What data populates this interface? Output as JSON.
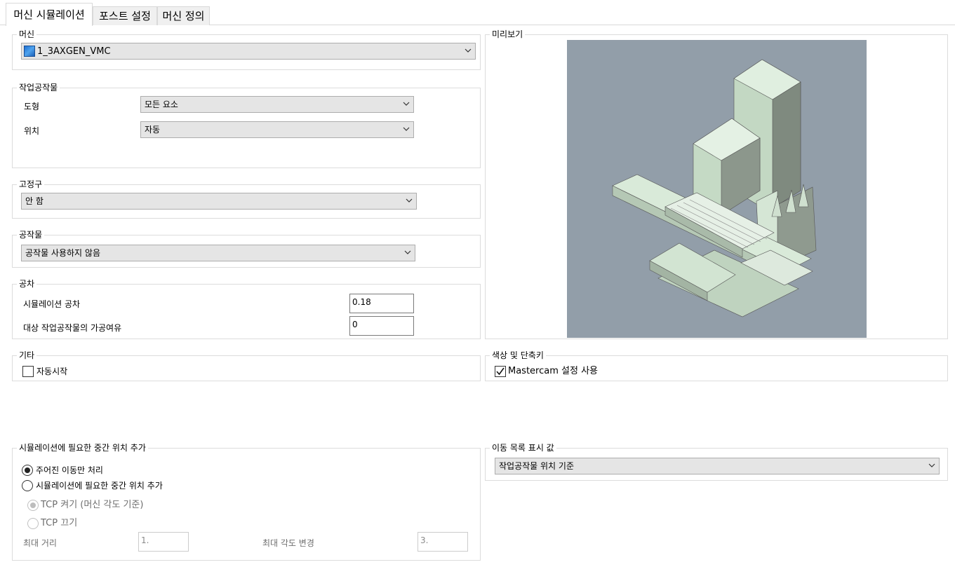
{
  "tabs": [
    {
      "label": "머신 시뮬레이션",
      "active": true
    },
    {
      "label": "포스트 설정",
      "active": false
    },
    {
      "label": "머신 정의",
      "active": false
    }
  ],
  "machine": {
    "legend": "머신",
    "selected": "1_3AXGEN_VMC",
    "icon": "machine-icon"
  },
  "workpiece": {
    "legend": "작업공작물",
    "geometry_label": "도형",
    "geometry_value": "모든 요소",
    "position_label": "위치",
    "position_value": "자동"
  },
  "fixture": {
    "legend": "고정구",
    "value": "안 함"
  },
  "stock": {
    "legend": "공작물",
    "value": "공작물 사용하지 않음"
  },
  "tolerance": {
    "legend": "공차",
    "sim_label": "시뮬레이션 공차",
    "sim_value": "0.18",
    "allowance_label": "대상 작업공작물의 가공여유",
    "allowance_value": "0"
  },
  "other": {
    "legend": "기타",
    "autostart_label": "자동시작",
    "autostart_checked": false
  },
  "colors_shortcuts": {
    "legend": "색상 및 단축키",
    "use_mastercam_label": "Mastercam 설정 사용",
    "use_mastercam_checked": true
  },
  "preview": {
    "legend": "미리보기",
    "bg_color": "#929ea9",
    "machine_color": "#d8ead8"
  },
  "intermediate": {
    "legend": "시뮬레이션에 필요한 중간 위치 추가",
    "radio_given_label": "주어진 이동만 처리",
    "radio_add_label": "시뮬레이션에 필요한 중간 위치 추가",
    "tcp_on_label": "TCP 켜기 (머신 각도 기준)",
    "tcp_off_label": "TCP 끄기",
    "max_distance_label": "최대 거리",
    "max_distance_value": "1.",
    "max_angle_label": "최대 각도 변경",
    "max_angle_value": "3."
  },
  "move_list": {
    "legend": "이동 목록 표시 값",
    "value": "작업공작물 위치 기준"
  }
}
